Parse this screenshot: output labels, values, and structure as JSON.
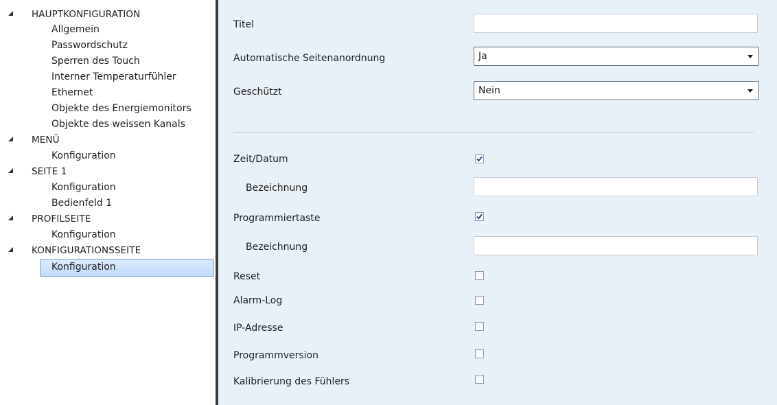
{
  "sidebar": {
    "sections": [
      {
        "label": "HAUPTKONFIGURATION",
        "children": [
          "Allgemein",
          "Passwordschutz",
          "Sperren des Touch",
          "Interner Temperaturfühler",
          "Ethernet",
          "Objekte des Energiemonitors",
          "Objekte des weissen Kanals"
        ]
      },
      {
        "label": "MENÜ",
        "children": [
          "Konfiguration"
        ]
      },
      {
        "label": "SEITE 1",
        "children": [
          "Konfiguration",
          "Bedienfeld 1"
        ]
      },
      {
        "label": "PROFILSEITE",
        "children": [
          "Konfiguration"
        ]
      },
      {
        "label": "KONFIGURATIONSSEITE",
        "children": [
          "Konfiguration"
        ]
      }
    ],
    "selected": "KONFIGURATIONSSEITE/Konfiguration"
  },
  "form": {
    "titel_label": "Titel",
    "titel_value": "",
    "auto_label": "Automatische Seitenanordnung",
    "auto_value": "Ja",
    "geschuetzt_label": "Geschützt",
    "geschuetzt_value": "Nein",
    "zeit_label": "Zeit/Datum",
    "zeit_checked": true,
    "zeit_bez_label": "Bezeichnung",
    "zeit_bez_value": "",
    "prog_label": "Programmiertaste",
    "prog_checked": true,
    "prog_bez_label": "Bezeichnung",
    "prog_bez_value": "",
    "reset_label": "Reset",
    "reset_checked": false,
    "alarm_label": "Alarm-Log",
    "alarm_checked": false,
    "ip_label": "IP-Adresse",
    "ip_checked": false,
    "version_label": "Programmversion",
    "version_checked": false,
    "kalib_label": "Kalibrierung des Fühlers",
    "kalib_checked": false
  },
  "colors": {
    "panel_bg": "#e9f1f8",
    "selection": "#c1dbfc",
    "check_mark": "#2a3f8f",
    "divider": "#3a3a3a"
  },
  "icons": {
    "expander": "collapse-triangle-icon",
    "checkbox": "checkmark-icon",
    "dropdown": "chevron-down-icon"
  }
}
